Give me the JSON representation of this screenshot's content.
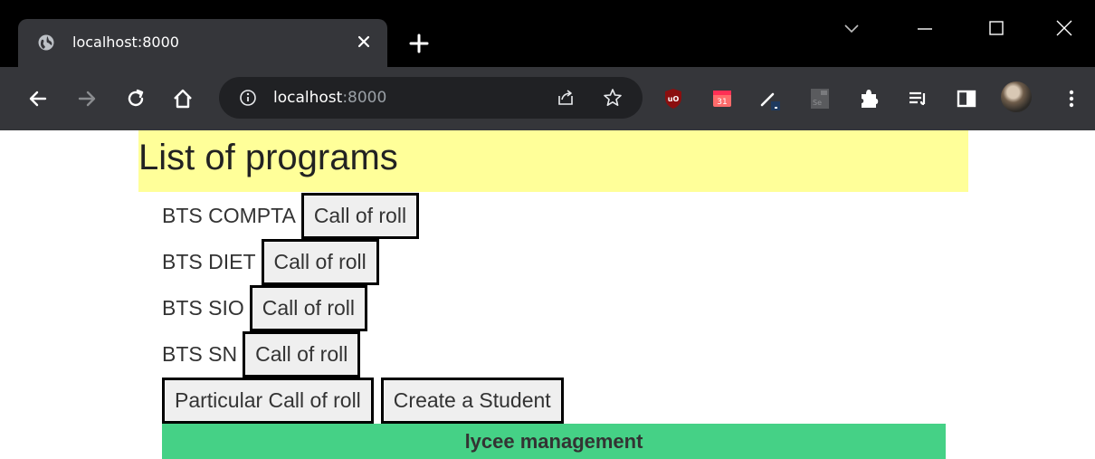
{
  "browser": {
    "tab": {
      "title": "localhost:8000"
    },
    "omnibox": {
      "host": "localhost",
      "port": ":8000"
    },
    "icons": {
      "favicon": "globe-icon",
      "close": "close-icon",
      "new_tab": "plus-icon",
      "back": "back-arrow-icon",
      "forward": "forward-arrow-icon",
      "reload": "reload-icon",
      "home": "home-icon",
      "info": "info-icon",
      "share": "share-icon",
      "bookmark": "star-icon",
      "extensions": "puzzle-icon",
      "reading_list": "reading-list-icon",
      "side_panel": "side-panel-icon",
      "menu": "kebab-menu-icon"
    },
    "colors": {
      "tabstrip": "#000000",
      "toolbar": "#35363a",
      "omnibox": "#202124"
    }
  },
  "page": {
    "title": "List of programs",
    "programs": [
      {
        "name": "BTS COMPTA",
        "button": "Call of roll"
      },
      {
        "name": "BTS DIET",
        "button": "Call of roll"
      },
      {
        "name": "BTS SIO",
        "button": "Call of roll"
      },
      {
        "name": "BTS SN",
        "button": "Call of roll"
      }
    ],
    "actions": {
      "particular_label": "Particular Call of roll",
      "create_label": "Create a Student"
    },
    "footer": "lycee management",
    "colors": {
      "header_bg": "#ffff99",
      "footer_bg": "#45d186",
      "button_bg": "#efefef",
      "button_border": "#000000"
    }
  }
}
